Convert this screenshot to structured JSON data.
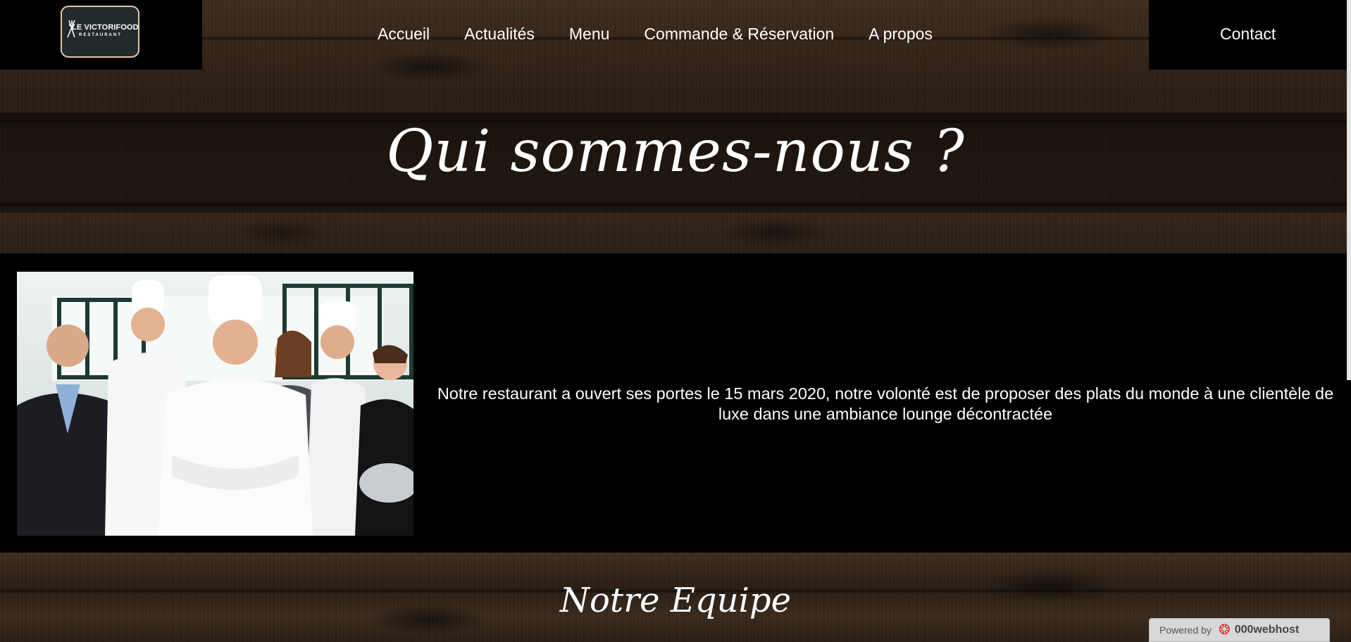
{
  "header": {
    "logo": {
      "title": "LE VICTORIFOOD",
      "subtitle": "RESTAURANT"
    },
    "nav": [
      {
        "label": "Accueil"
      },
      {
        "label": "Actualités"
      },
      {
        "label": "Menu"
      },
      {
        "label": "Commande & Réservation"
      },
      {
        "label": "A propos"
      }
    ],
    "contact_label": "Contact"
  },
  "hero": {
    "title": "Qui sommes-nous ?"
  },
  "about": {
    "text": "Notre restaurant a ouvert ses portes le 15 mars 2020, notre volonté est de proposer des plats du monde à une clientèle de luxe dans une ambiance lounge décontractée"
  },
  "team": {
    "title": "Notre Equipe"
  },
  "footer_badge": {
    "powered_label": "Powered by",
    "host_label": "000webhost"
  },
  "colors": {
    "logo_border": "#e7c3a6",
    "logo_fill": "#222a2e",
    "background": "#000000"
  }
}
